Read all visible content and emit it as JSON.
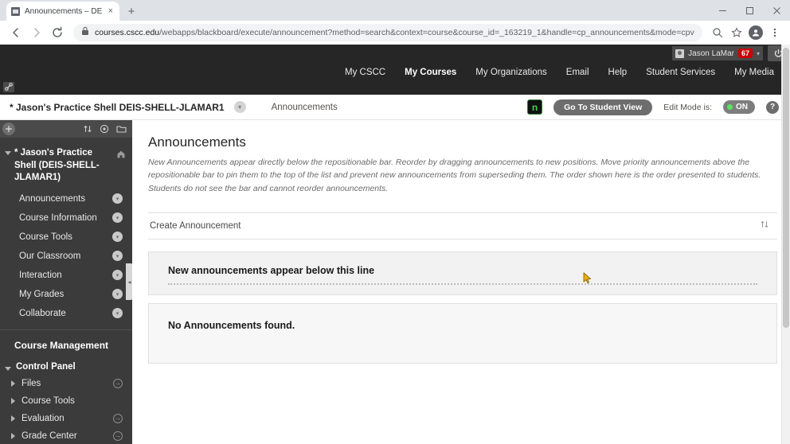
{
  "browser": {
    "tab": {
      "title": "Announcements – DEIS-SHELL-J",
      "favicon": "page-icon",
      "close": "×"
    },
    "new_tab_label": "+",
    "window_controls": {
      "minimize": "minimize",
      "maximize": "maximize",
      "close": "close"
    },
    "nav": {
      "back": "←",
      "forward": "→",
      "reload": "⟳"
    },
    "omnibox": {
      "lock_icon": "lock-icon",
      "url_domain": "courses.cscc.edu",
      "url_path": "/webapps/blackboard/execute/announcement?method=search&context=course&course_id=_163219_1&handle=cp_announcements&mode=cpview"
    },
    "toolbar_icons": [
      "zoom-icon",
      "bookmark-star-icon",
      "profile-avatar-icon",
      "more-menu-icon"
    ]
  },
  "global_nav": {
    "user": {
      "name": "Jason LaMar",
      "badge_count": "67",
      "caret": "▾"
    },
    "power_icon": "power-icon",
    "links": [
      {
        "label": "My CSCC",
        "active": false
      },
      {
        "label": "My Courses",
        "active": true
      },
      {
        "label": "My Organizations",
        "active": false
      },
      {
        "label": "Email",
        "active": false
      },
      {
        "label": "Help",
        "active": false
      },
      {
        "label": "Student Services",
        "active": false
      },
      {
        "label": "My Media",
        "active": false
      }
    ],
    "link_icon": "chain-link-icon"
  },
  "course_bar": {
    "course_title": "* Jason's Practice Shell DEIS-SHELL-JLAMAR1",
    "course_chevron": "▾",
    "breadcrumb": "Announcements",
    "nav_badge": "n",
    "student_view_button": "Go To Student View",
    "edit_mode_label": "Edit Mode is:",
    "edit_mode_state": "ON",
    "help_button": "?"
  },
  "sidebar": {
    "toolbar_icons": [
      "add-icon",
      "reorder-icon",
      "refresh-icon",
      "folder-icon"
    ],
    "course_name": "* Jason's Practice Shell (DEIS-SHELL-JLAMAR1)",
    "home_icon": "home-icon",
    "items": [
      {
        "label": "Announcements",
        "chevron": "▾"
      },
      {
        "label": "Course Information",
        "chevron": "▾"
      },
      {
        "label": "Course Tools",
        "chevron": "▾"
      },
      {
        "label": "Our Classroom",
        "chevron": "▾"
      },
      {
        "label": "Interaction",
        "chevron": "▾"
      },
      {
        "label": "My Grades",
        "chevron": "▾"
      },
      {
        "label": "Collaborate",
        "chevron": "▾"
      }
    ],
    "management_heading": "Course Management",
    "control_panel_label": "Control Panel",
    "control_panel_items": [
      {
        "label": "Files",
        "has_arrow": true
      },
      {
        "label": "Course Tools",
        "has_arrow": false
      },
      {
        "label": "Evaluation",
        "has_arrow": true
      },
      {
        "label": "Grade Center",
        "has_arrow": true
      }
    ],
    "collapse_handle": "◂"
  },
  "content": {
    "heading": "Announcements",
    "description": "New Announcements appear directly below the repositionable bar. Reorder by dragging announcements to new positions. Move priority announcements above the repositionable bar to pin them to the top of the list and prevent new announcements from superseding them. The order shown here is the order presented to students. Students do not see the bar and cannot reorder announcements.",
    "create_announcement_label": "Create Announcement",
    "sort_icon": "sort-icon",
    "repositionable_bar_label": "New announcements appear below this line",
    "empty_message": "No Announcements found."
  },
  "colors": {
    "dark_nav": "#262626",
    "sidebar": "#3b3b3b",
    "badge_red": "#cc0000",
    "toggle_green": "#5ee05e",
    "link_gray": "#6d6d6d"
  }
}
